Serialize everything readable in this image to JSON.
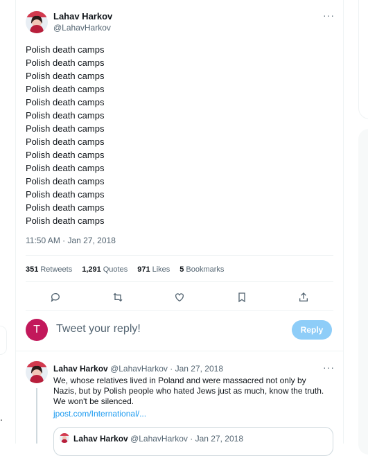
{
  "tweet": {
    "author_name": "Lahav Harkov",
    "author_handle": "@LahavHarkov",
    "more_label": "···",
    "lines": [
      "Polish death camps",
      "Polish death camps",
      "Polish death camps",
      "Polish death camps",
      "Polish death camps",
      "Polish death camps",
      "Polish death camps",
      "Polish death camps",
      "Polish death camps",
      "Polish death camps",
      "Polish death camps",
      "Polish death camps",
      "Polish death camps",
      "Polish death camps"
    ],
    "timestamp": "11:50 AM · Jan 27, 2018",
    "stats": {
      "retweets_count": "351",
      "retweets_label": "Retweets",
      "quotes_count": "1,291",
      "quotes_label": "Quotes",
      "likes_count": "971",
      "likes_label": "Likes",
      "bookmarks_count": "5",
      "bookmarks_label": "Bookmarks"
    },
    "actions": [
      "reply-icon",
      "retweet-icon",
      "heart-icon",
      "bookmark-icon",
      "share-icon"
    ]
  },
  "reply_box": {
    "avatar_letter": "T",
    "avatar_color": "#c2185b",
    "placeholder": "Tweet your reply!",
    "button_label": "Reply",
    "button_color": "#8ecdf8"
  },
  "quoted_tweet": {
    "author_name": "Lahav Harkov",
    "author_handle": "@LahavHarkov",
    "date": "· Jan 27, 2018",
    "text": "We, whose relatives lived in Poland and were massacred not only by Nazis, but by Polish people who hated Jews just as much, know the truth. We won't be silenced.",
    "link": "jpost.com/International/...",
    "more_label": "···",
    "embedded": {
      "author_name": "Lahav Harkov",
      "author_handle": "@LahavHarkov",
      "date": "· Jan 27, 2018"
    }
  },
  "left_panel": {
    "dot": "."
  },
  "colors": {
    "accent": "#1d9bf0",
    "muted": "#536471",
    "border": "#eff3f4"
  }
}
